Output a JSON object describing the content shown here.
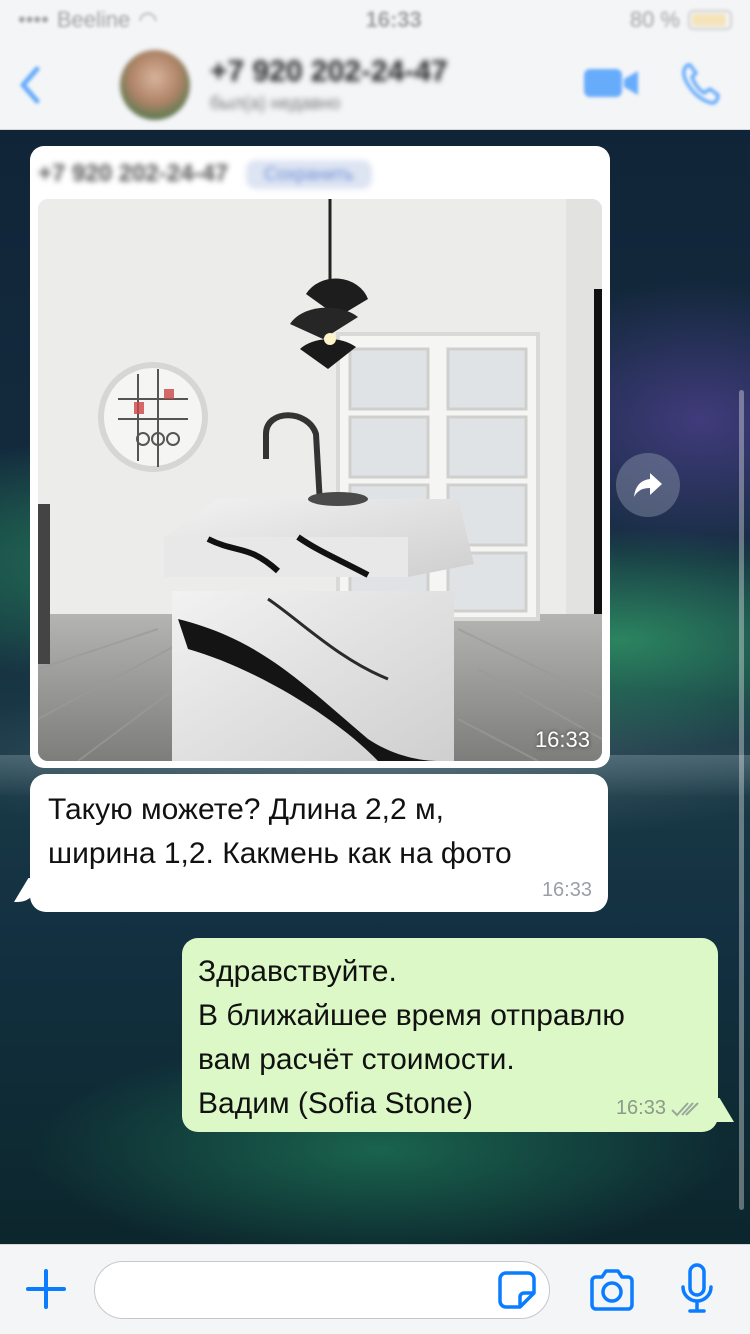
{
  "status_bar": {
    "carrier": "Beeline",
    "time": "16:33",
    "battery": "80 %"
  },
  "header": {
    "back_label": "<",
    "contact_name": "+7 920 202-24-47",
    "contact_status": "был(а) недавно"
  },
  "messages": {
    "image_message": {
      "forwarded_from": "+7 920 202-24-47",
      "forwarded_tag": "Сохранить",
      "time": "16:33"
    },
    "incoming_text": {
      "text": "Такую можете? Длина 2,2 м,\nширина 1,2. Какмень как на фото",
      "time": "16:33"
    },
    "outgoing_text": {
      "text": "Здравствуйте.\nВ ближайшее время отправлю\nвам расчёт стоимости.\nВадим (Sofia Stone)",
      "time": "16:33"
    }
  },
  "input": {
    "placeholder": "",
    "value": ""
  },
  "colors": {
    "accent": "#0a7cff",
    "outgoing_bubble": "#dcf8c6",
    "incoming_bubble": "#ffffff"
  }
}
